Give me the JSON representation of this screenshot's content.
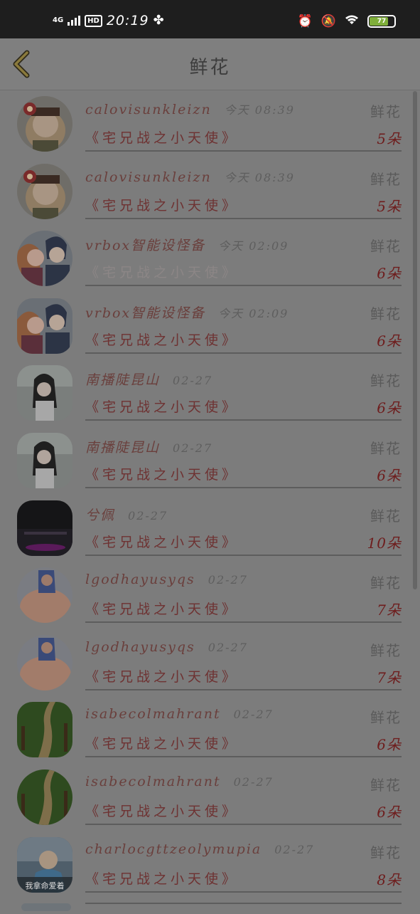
{
  "status_bar": {
    "network": "4G",
    "hd": "HD",
    "time": "20:19",
    "battery": "77",
    "battery_level": 0.77,
    "icons": [
      "fan-icon",
      "alarm-icon",
      "mute-icon",
      "wifi-icon",
      "battery-icon"
    ]
  },
  "header": {
    "title": "鲜花",
    "back_icon": "chevron-left-icon"
  },
  "list": [
    {
      "user": "calovisunkleizn",
      "time": "今天 08:39",
      "type": "鲜花",
      "book": "《宅兄战之小天使》",
      "count": "5朵"
    },
    {
      "user": "calovisunkleizn",
      "time": "今天 08:39",
      "type": "鲜花",
      "book": "《宅兄战之小天使》",
      "count": "5朵"
    },
    {
      "user": "vrbox智能设怪备",
      "time": "今天 02:09",
      "type": "鲜花",
      "book": "《宅兄战之小天使》",
      "count": "6朵"
    },
    {
      "user": "vrbox智能设怪备",
      "time": "今天 02:09",
      "type": "鲜花",
      "book": "《宅兄战之小天使》",
      "count": "6朵"
    },
    {
      "user": "南播陡昆山",
      "time": "02-27",
      "type": "鲜花",
      "book": "《宅兄战之小天使》",
      "count": "6朵"
    },
    {
      "user": "南播陡昆山",
      "time": "02-27",
      "type": "鲜花",
      "book": "《宅兄战之小天使》",
      "count": "6朵"
    },
    {
      "user": "兮佩",
      "time": "02-27",
      "type": "鲜花",
      "book": "《宅兄战之小天使》",
      "count": "10朵"
    },
    {
      "user": "lgodhayusyqs",
      "time": "02-27",
      "type": "鲜花",
      "book": "《宅兄战之小天使》",
      "count": "7朵"
    },
    {
      "user": "lgodhayusyqs",
      "time": "02-27",
      "type": "鲜花",
      "book": "《宅兄战之小天使》",
      "count": "7朵"
    },
    {
      "user": "isabecolmahrant",
      "time": "02-27",
      "type": "鲜花",
      "book": "《宅兄战之小天使》",
      "count": "6朵"
    },
    {
      "user": "isabecolmahrant",
      "time": "02-27",
      "type": "鲜花",
      "book": "《宅兄战之小天使》",
      "count": "6朵"
    },
    {
      "user": "charlocgttzeolymupia",
      "time": "02-27",
      "type": "鲜花",
      "book": "《宅兄战之小天使》",
      "count": "8朵",
      "avatar_caption": "我拿命爱着"
    }
  ],
  "colors": {
    "overlay_bg": "#7c7c7c",
    "status_bar": "#1e1e1e",
    "username": "#6a3f3c",
    "book_title": "#6e3232",
    "count": "#6e1d1d",
    "battery_fill": "#7fae3a"
  }
}
